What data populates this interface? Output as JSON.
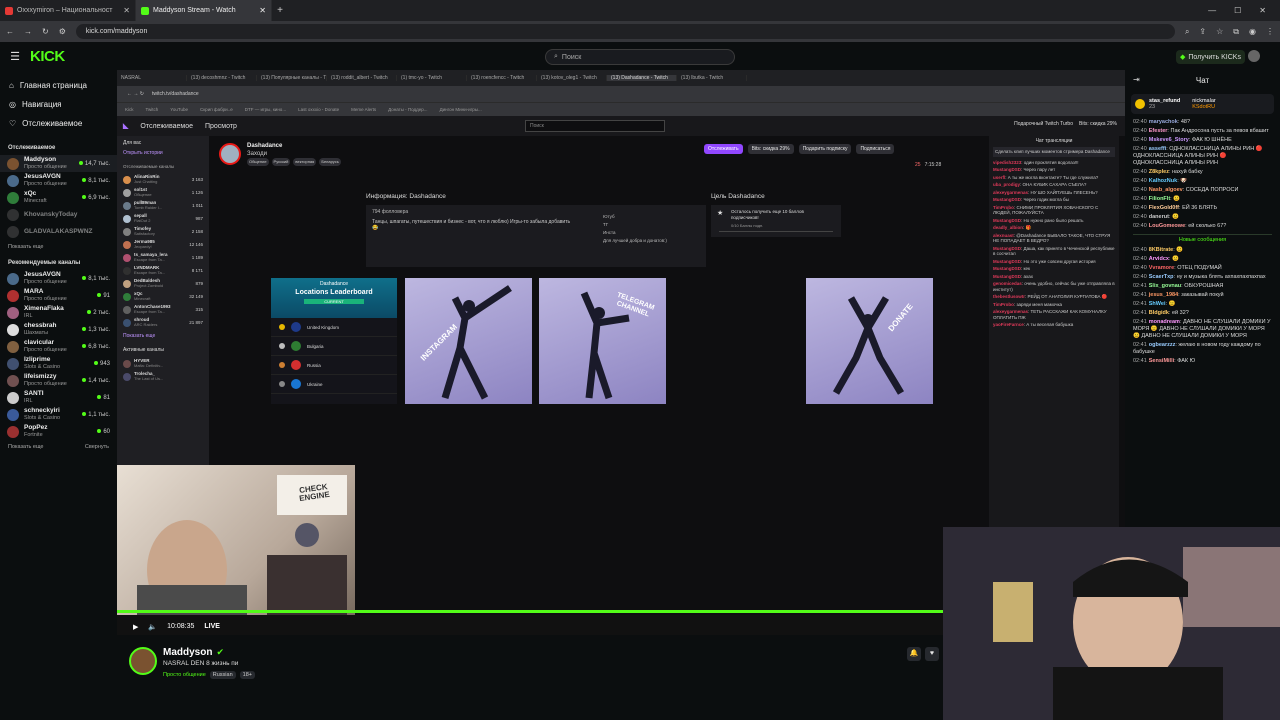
{
  "browser": {
    "tabs": [
      {
        "title": "Oxxxymiron – Национальност",
        "color": "#e53935",
        "active": false
      },
      {
        "title": "Maddyson Stream - Watch",
        "color": "#53fc18",
        "active": true
      }
    ],
    "url": "kick.com/maddyson"
  },
  "header": {
    "logo": "KICK",
    "search_placeholder": "Поиск",
    "get_kicks": "Получить KICKs"
  },
  "sidebar": {
    "nav": [
      {
        "icon": "home-icon",
        "label": "Главная страница"
      },
      {
        "icon": "compass-icon",
        "label": "Навигация"
      },
      {
        "icon": "heart-icon",
        "label": "Отслеживаемое"
      }
    ],
    "following_title": "Отслеживаемое",
    "following": [
      {
        "name": "Maddyson",
        "sub": "Просто общение",
        "viewers": "14,7 тыс.",
        "color": "#7a5230"
      },
      {
        "name": "JesusAVGN",
        "sub": "Просто общение",
        "viewers": "8,1 тыс.",
        "color": "#4a6a8a"
      },
      {
        "name": "xQc",
        "sub": "Minecraft",
        "viewers": "6,9 тыс.",
        "color": "#2f7d3a"
      },
      {
        "name": "KhovanskyToday",
        "sub": "",
        "viewers": "",
        "color": "#555"
      },
      {
        "name": "GLADVALAKASPWNZ",
        "sub": "",
        "viewers": "",
        "color": "#555"
      }
    ],
    "show_more": "Показать еще",
    "recommended_title": "Рекомендуемые каналы",
    "recommended": [
      {
        "name": "JesusAVGN",
        "sub": "Просто общение",
        "viewers": "8,1 тыс.",
        "color": "#4a6a8a"
      },
      {
        "name": "MARA",
        "sub": "Просто общение",
        "viewers": "91",
        "color": "#b03030"
      },
      {
        "name": "XimenaFlaka",
        "sub": "IRL",
        "viewers": "2 тыс.",
        "color": "#a06080"
      },
      {
        "name": "chessbrah",
        "sub": "Шахматы",
        "viewers": "1,3 тыс.",
        "color": "#ddd"
      },
      {
        "name": "clavicular",
        "sub": "Просто общение",
        "viewers": "6,8 тыс.",
        "color": "#806040"
      },
      {
        "name": "lzliprime",
        "sub": "Slots & Casino",
        "viewers": "943",
        "color": "#405070"
      },
      {
        "name": "lifeismizzy",
        "sub": "Просто общение",
        "viewers": "1,4 тыс.",
        "color": "#705050"
      },
      {
        "name": "SANTI",
        "sub": "IRL",
        "viewers": "81",
        "color": "#ccc"
      },
      {
        "name": "schneckyiri",
        "sub": "Slots & Casino",
        "viewers": "1,1 тыс.",
        "color": "#3a5a9a"
      },
      {
        "name": "PopPez",
        "sub": "Fortnite",
        "viewers": "60",
        "color": "#9a3030"
      }
    ],
    "show_more2": "Показать еще",
    "collapse": "Свернуть"
  },
  "inner_browser": {
    "tabs": [
      "NASRAL",
      "(13) decoshmnz - Twitch",
      "(13) Популярные каналы - Tw",
      "(13) roddit_albert - Twitch",
      "(1) tmc-yo - Twitch",
      "(13) roencfencc - Twitch",
      "(13) kotov_oleg1 - Twitch",
      "(13) Dashadance - Twitch",
      "(13) lbutka - Twitch"
    ],
    "url": "twitch.tv/dashadance",
    "bookmarks": [
      "Kick",
      "Twitch",
      "YouTube",
      "Скрип фабри..е",
      "DTF — игры, кино...",
      "Last oxxxio - Donate",
      "Meme Alerts",
      "Донаты - Поддер...",
      "Дингон Мини-игры..."
    ]
  },
  "twitch": {
    "nav": [
      "Отслеживаемое",
      "Просмотр"
    ],
    "search": "Поиск",
    "turbo": "Подарочный Twitch Turbo",
    "bits": "Bits: скидка 29%",
    "left_title": "Для вас",
    "left_sub": "Открыть истории",
    "left_section": "Отслеживаемые каналы",
    "channels": [
      {
        "name": "AlinaRinRin",
        "sub": "Just Chatting",
        "v": "3 163",
        "color": "#d98f4c"
      },
      {
        "name": "sol1st",
        "sub": "Общение",
        "v": "1 126",
        "color": "#a0a0a0"
      },
      {
        "name": "pull89man",
        "sub": "Tomb Raider I...",
        "v": "1 011",
        "color": "#6a7a8a"
      },
      {
        "name": "sepall",
        "sub": "FlatOut 2",
        "v": "987",
        "color": "#b0c0d0"
      },
      {
        "name": "Timofey",
        "sub": "Satisfactory",
        "v": "2 158",
        "color": "#808080"
      },
      {
        "name": "Jerma985",
        "sub": "Jeopardy!",
        "v": "12 146",
        "color": "#c07050"
      },
      {
        "name": "ts_samaya_lera",
        "sub": "Escape from Ta...",
        "v": "1 189",
        "color": "#b05070"
      },
      {
        "name": "LVNDMARK",
        "sub": "Escape from Ta...",
        "v": "8 171",
        "color": "#303030"
      },
      {
        "name": "DedBaldesh",
        "sub": "Project Zomboid",
        "v": "879",
        "color": "#c0a080"
      },
      {
        "name": "xQc",
        "sub": "Minecraft",
        "v": "32 149",
        "color": "#2f7d3a"
      },
      {
        "name": "AntonChase1993",
        "sub": "Escape from Ta...",
        "v": "315",
        "color": "#606060"
      },
      {
        "name": "shroud",
        "sub": "ARC Raiders",
        "v": "21 897",
        "color": "#3a5070"
      }
    ],
    "show_more": "Показать еще",
    "active_title": "Активные каналы",
    "active": [
      {
        "name": "HYVER",
        "sub": "Mafia: Definitiv...",
        "v": "",
        "color": "#6a4a4a"
      },
      {
        "name": "Trolecha_",
        "sub": "The Last of Us...",
        "v": "",
        "color": "#4a4a6a"
      }
    ],
    "streamer": "Dashadance",
    "streamer_sub": "Заходи",
    "tags": [
      "Общение",
      "Русский",
      "векторная",
      "Беларусь"
    ],
    "follow": "Отслеживать",
    "bits_disc": "Bits: скидка 29%",
    "gift": "Подарить подписку",
    "subscribe": "Подписаться",
    "viewers": "25",
    "uptime": "7:15:28",
    "about_title": "Информация: Dashadance",
    "followers": "794 фолловера",
    "about_text": "Танцы, шпагаты, путешествия и бизнес - вот, что я люблю) Игры-то забыла добавить😂",
    "links": [
      "Ютуб",
      "ТГ",
      "Инста",
      "Для лучшей добра и донатов:)"
    ],
    "goal_title": "Цель Dashadance",
    "goal_text": "Осталось получить еще 10 баллов подписчиков!",
    "goal_progress": "0/10 Баллы подп.",
    "leaderboard_title": "Dashadance",
    "leaderboard_sub": "Locations Leaderboard",
    "leaderboard_current": "CURRENT",
    "countries": [
      {
        "name": "United Kingdom",
        "flag": "#1e3a8a",
        "medal": "#e6b800"
      },
      {
        "name": "Bulgaria",
        "flag": "#2e7d32",
        "medal": "#bdbdbd"
      },
      {
        "name": "Russia",
        "flag": "#d32f2f",
        "medal": "#cd7f32"
      },
      {
        "name": "Ukraine",
        "flag": "#1976d2",
        "medal": "#888"
      }
    ],
    "panels": [
      "INSTAGRAM",
      "TELEGRAM CHANNEL",
      "DONATE"
    ],
    "chat_title": "Чат трансляции",
    "chat_clip": "Сделать клип лучших моментов стримера Dashadance",
    "chat_msgs": [
      {
        "u": "vipedish2323",
        "t": "один проклятия водолаз!!!"
      },
      {
        "u": "MustangDSD",
        "t": "Через пару лет"
      },
      {
        "u": "userfl",
        "t": "А ты же могла вконтакте? Ты где служила?"
      },
      {
        "u": "uba_prodigy",
        "t": "ОНА КУБИК САХАРА СЪЕЛА?"
      },
      {
        "u": "alexeygarmenas",
        "t": "НУ ШО ХАЙПУЕШЬ ПЛЕСЕНЬ?"
      },
      {
        "u": "MustangDSD",
        "t": "Через годик могла бы"
      },
      {
        "u": "TimProbo",
        "t": "СНИМИ ПРОКЛЯТИЯ ХОВАНСКОГО С ЛЮДЕЙ, ПОЖАЛУЙСТА"
      },
      {
        "u": "MustangDSD",
        "t": "Но нужно рано было решать"
      },
      {
        "u": "deadly_albion",
        "t": "🎁"
      },
      {
        "u": "alexnuast",
        "t": "@Dashadance БЫВАЛО ТАКОЕ, ЧТО СТРУЯ НЕ ПОПАДАЕТ В ВЕДРО?"
      },
      {
        "u": "MustangDSD",
        "t": "Даша, как принято в Чеченской республике в сосчитал"
      },
      {
        "u": "MustangDSD",
        "t": "Но это уже совсем другая история"
      },
      {
        "u": "MustangDSD",
        "t": "кек"
      },
      {
        "u": "MustangDSD",
        "t": "ахах"
      },
      {
        "u": "genomicedas",
        "t": "очень удобно, сейчас бы уже отправляла в институт)"
      },
      {
        "u": "thebestlusowtr",
        "t": "РЕЙД ОТ АНАТОЛИЯ КУРПАТОВА 🔴"
      },
      {
        "u": "TimProbo",
        "t": "заряди меня мамочка"
      },
      {
        "u": "alexeygarmenas",
        "t": "ТЕТЬ РАССКАЖИ КАК КОМУНАЛКУ ОПЛАТИТЬ ПЖ"
      },
      {
        "u": "yaoFireFarnce",
        "t": "А ты веселая бабушка"
      }
    ]
  },
  "player": {
    "time": "10:08:35",
    "live": "LIVE",
    "webcam_sign": "CHECK ENGINE"
  },
  "stream_info": {
    "name": "Maddyson",
    "title": "NASRAL DEN 8 жизнь пи",
    "category": "Просто общение",
    "tag1": "Russian",
    "tag2": "18+"
  },
  "chat": {
    "title": "Чат",
    "pinned_user": "stas_refund",
    "pinned_count": "23",
    "pinned_user2": "nickmalar",
    "pinned_user3": "KSdotRU",
    "new_messages": "Новые сообщения",
    "messages": [
      {
        "t": "02:40",
        "u": "maryachok",
        "c": "#9ad",
        "m": "48?"
      },
      {
        "t": "02:40",
        "u": "Efester",
        "c": "#f9c",
        "m": "Пак Андросона пусть за певов вбашит"
      },
      {
        "t": "02:40",
        "u": "Mskeve6_Story",
        "c": "#c9f",
        "m": "ФАК Ю ШНЁНЕ"
      },
      {
        "t": "02:40",
        "u": "asseffi",
        "c": "#9cf",
        "m": "ОДНОКЛАССНИЦА АЛИНЫ РИН 🔴 ОДНОКЛАССНИЦА АЛИНЫ РИН 🔴 ОДНОКЛАССНИЦА АЛИНЫ РИН"
      },
      {
        "t": "02:40",
        "u": "Z8kplez",
        "c": "#fc6",
        "m": "нахуй бабку"
      },
      {
        "t": "02:40",
        "u": "KalhozNuk",
        "c": "#6cf",
        "m": "🐶"
      },
      {
        "t": "02:40",
        "u": "Nasb_algoev",
        "c": "#f96",
        "m": "СОСЕДА ПОПРОСИ"
      },
      {
        "t": "02:40",
        "u": "FilionFlt",
        "c": "#9f9",
        "m": "😐"
      },
      {
        "t": "02:40",
        "u": "FlexGold0ff",
        "c": "#fc9",
        "m": "ЕЙ 36 БЛЯТЬ"
      },
      {
        "t": "02:40",
        "u": "danerut",
        "c": "#ccc",
        "m": "😐"
      },
      {
        "t": "02:40",
        "u": "LouGomeowe",
        "c": "#f99",
        "m": "ей сколько 67?"
      },
      {
        "t": "02:40",
        "u": "8KBitrate",
        "c": "#fc6",
        "m": "😐"
      },
      {
        "t": "02:40",
        "u": "Arvidcx",
        "c": "#f9f",
        "m": "😐"
      },
      {
        "t": "02:40",
        "u": "Vvramore",
        "c": "#f66",
        "m": "ОТЕЦ ПОДУМАЙ"
      },
      {
        "t": "02:40",
        "u": "ScaerTxp",
        "c": "#9cf",
        "m": "ну и музыка блять ахпахпахпахпах"
      },
      {
        "t": "02:41",
        "u": "Slix_govnau",
        "c": "#9f9",
        "m": "ОБКУРОШНАЯ"
      },
      {
        "t": "02:41",
        "u": "jesus_1984",
        "c": "#f96",
        "m": "заказывай покуй"
      },
      {
        "t": "02:41",
        "u": "ShWei",
        "c": "#6cf",
        "m": "😐"
      },
      {
        "t": "02:41",
        "u": "Bldgidk",
        "c": "#fc6",
        "m": "ей 32?"
      },
      {
        "t": "02:41",
        "u": "monadream",
        "c": "#f9f",
        "m": "ДАВНО НЕ СЛУШАЛИ ДОМИКИ У МОРЯ 😐 ДАВНО НЕ СЛУШАЛИ ДОМИКИ У МОРЯ 😐 ДАВНО НЕ СЛУШАЛИ ДОМИКИ У МОРЯ"
      },
      {
        "t": "02:41",
        "u": "ogbearzzz",
        "c": "#9cf",
        "m": "желаю в новом году каждому по бабушке"
      },
      {
        "t": "02:41",
        "u": "SensiMilli",
        "c": "#f99",
        "m": "ФАК Ю"
      }
    ]
  }
}
